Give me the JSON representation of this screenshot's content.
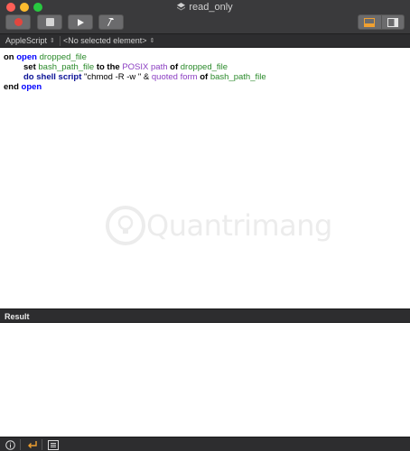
{
  "window": {
    "title": "read_only"
  },
  "toolbar": {
    "record_icon": "record-icon",
    "stop_icon": "stop-icon",
    "run_icon": "play-icon",
    "compile_icon": "hammer-icon",
    "view_bottom_icon": "bottom-panel-icon",
    "view_side_icon": "side-panel-icon"
  },
  "navbar": {
    "language": "AppleScript",
    "element": "<No selected element>"
  },
  "script": {
    "line1": {
      "kw1": "on",
      "kw2": "open",
      "var": "dropped_file"
    },
    "line2": {
      "kw1": "set",
      "var1": "bash_path_file",
      "kw2": "to the",
      "app": "POSIX path",
      "kw3": "of",
      "var2": "dropped_file"
    },
    "line3": {
      "kw1": "do shell script",
      "str": "\"chmod -R -w \" &",
      "app": "quoted form",
      "kw2": "of",
      "var": "bash_path_file"
    },
    "line4": {
      "kw1": "end",
      "kw2": "open"
    }
  },
  "watermark": {
    "text": "Quantrimang"
  },
  "result": {
    "header": "Result"
  },
  "colors": {
    "titlebar": "#3a3a3c",
    "bar": "#2d2d2f",
    "keyword": "#000000",
    "event_keyword": "#0000ff",
    "command_keyword": "#0a1296",
    "variable": "#2b8a2b",
    "property": "#8b3ec2",
    "record_red": "#e2463e",
    "return_orange": "#f0a030"
  }
}
